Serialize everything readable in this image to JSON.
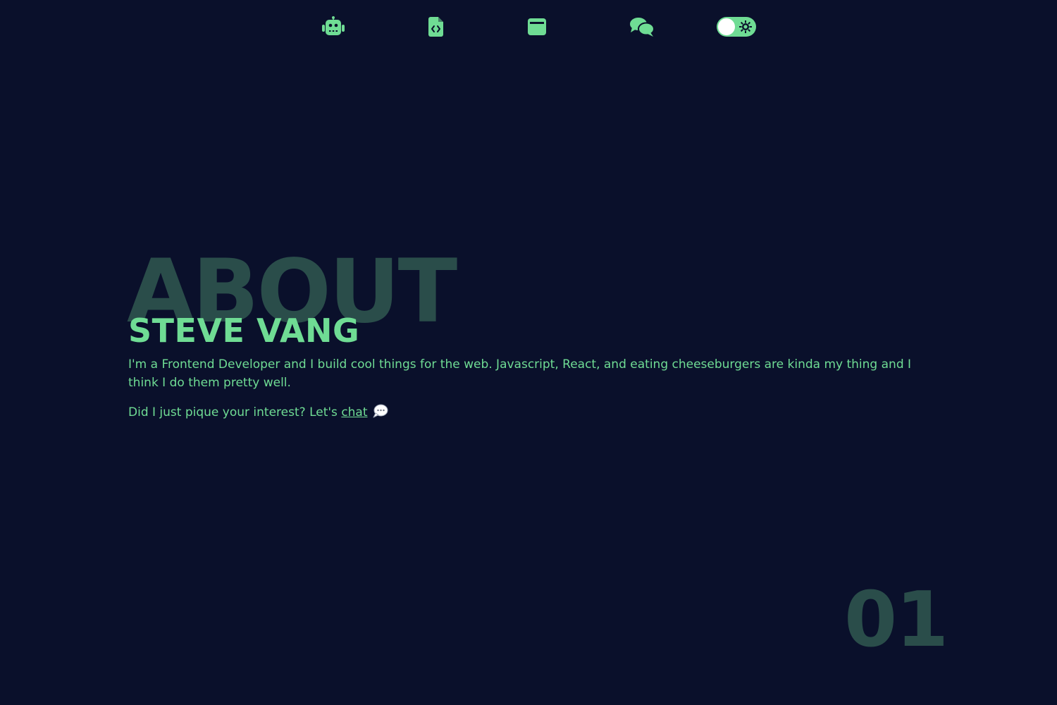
{
  "colors": {
    "background": "#0a102b",
    "accent": "#6fdc94",
    "faded": "#2a4d4a"
  },
  "nav": {
    "icons": [
      "robot-icon",
      "code-file-icon",
      "window-icon",
      "chat-icon"
    ],
    "theme_toggle": {
      "icon": "sun-icon",
      "state": "off"
    }
  },
  "about": {
    "background_heading": "ABOUT",
    "name": "STEVE VANG",
    "bio": "I'm a Frontend Developer and I build cool things for the web. Javascript, React, and eating cheeseburgers are kinda my thing and I think I do them pretty well.",
    "cta_text": "Did I just pique your interest? Let's ",
    "cta_link": "chat",
    "cta_icon": "speech-bubble-icon"
  },
  "section_number": "01"
}
